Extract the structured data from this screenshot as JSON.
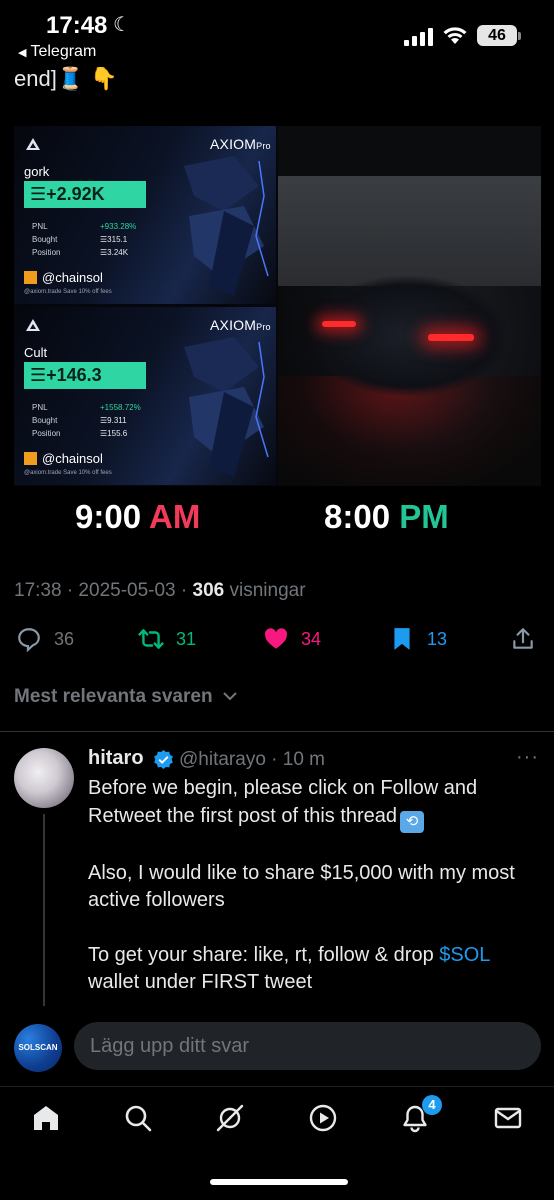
{
  "status_bar": {
    "time": "17:48",
    "back_app": "Telegram",
    "battery": "46"
  },
  "thread_end_text": "end]🧵 👇",
  "media": {
    "cards": [
      {
        "brand": "AXIOM",
        "brand_suffix": "Pro",
        "token": "gork",
        "pnl_value": "☰+2.92K",
        "row_labels": [
          "PNL",
          "Bought",
          "Position"
        ],
        "row_values": [
          "+933.28%",
          "☰315.1",
          "☰3.24K"
        ],
        "handle": "@chainsol",
        "footer": "@axiom.trade   Save 10% off fees"
      },
      {
        "brand": "AXIOM",
        "brand_suffix": "Pro",
        "token": "Cult",
        "pnl_value": "☰+146.3",
        "row_labels": [
          "PNL",
          "Bought",
          "Position"
        ],
        "row_values": [
          "+1558.72%",
          "☰9.311",
          "☰155.6"
        ],
        "handle": "@chainsol",
        "footer": "@axiom.trade   Save 10% off fees"
      }
    ],
    "time_left": "9:00",
    "time_left_suffix": "AM",
    "time_right": "8:00",
    "time_right_suffix": "PM"
  },
  "tweet_meta": {
    "time_date": "17:38 · 2025-05-03 · ",
    "views_count": "306",
    "views_label": " visningar"
  },
  "actions": {
    "replies": "36",
    "retweets": "31",
    "likes": "34",
    "bookmarks": "13"
  },
  "sort_label": "Mest relevanta svaren",
  "reply": {
    "name": "hitaro",
    "handle": "@hitarayo · 10 m",
    "more": "···",
    "para1": "Before we begin, please click on Follow and Retweet the first post of this thread",
    "para2": "Also, I would like to share $15,000 with my most active followers",
    "para3_before": "To get your share: like, rt, follow & drop ",
    "para3_cashtag": "$SOL",
    "para3_after": " wallet under FIRST tweet"
  },
  "composer": {
    "avatar_text": "SOLSCAN",
    "placeholder": "Lägg upp ditt svar"
  },
  "tabbar": {
    "notifications_badge": "4"
  },
  "colors": {
    "accent_blue": "#1d9bf0",
    "retweet_green": "#00ba7c",
    "like_pink": "#f91880",
    "am_red": "#f23a5b",
    "pm_green": "#23c496",
    "pnl_green": "#2fd5a2"
  }
}
